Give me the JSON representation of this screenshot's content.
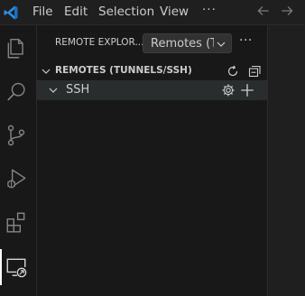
{
  "menu": {
    "items": [
      {
        "label": "File"
      },
      {
        "label": "Edit"
      },
      {
        "label": "Selection"
      },
      {
        "label": "View"
      }
    ],
    "more": "···"
  },
  "activity_bar": {
    "items": [
      {
        "icon": "explorer-icon"
      },
      {
        "icon": "search-icon"
      },
      {
        "icon": "source-control-icon"
      },
      {
        "icon": "run-debug-icon"
      },
      {
        "icon": "extensions-icon"
      },
      {
        "icon": "remote-explorer-icon",
        "active": true
      }
    ]
  },
  "sidebar": {
    "title": "REMOTE EXPLOR...",
    "dropdown": {
      "value": "Remotes (Tu"
    },
    "more": "···",
    "section": {
      "label": "REMOTES (TUNNELS/SSH)",
      "expanded": true
    },
    "tree": [
      {
        "label": "SSH",
        "expanded": true
      }
    ]
  },
  "colors": {
    "accent": "#0078d4",
    "background": "#1f1f1f",
    "sidebar": "#181818",
    "hover_row": "#2a2d2e"
  }
}
